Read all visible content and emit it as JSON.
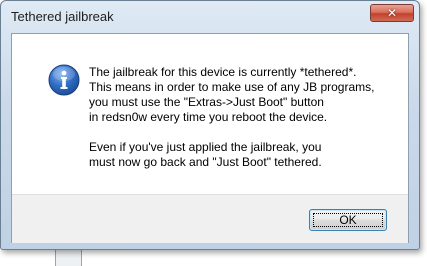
{
  "dialog": {
    "title": "Tethered jailbreak",
    "close_glyph": "✕",
    "icon": "info-icon",
    "message": {
      "paragraph1_lines": [
        "The jailbreak for this device is currently *tethered*.",
        "This means in order to make use of any JB programs,",
        "you must use the \"Extras->Just Boot\" button",
        "in redsn0w every time you reboot the device."
      ],
      "paragraph2_lines": [
        "Even if you've just applied the jailbreak, you",
        "must now go back and \"Just Boot\" tethered."
      ]
    },
    "ok_label": "OK"
  },
  "colors": {
    "close_button": "#c4422c",
    "frame": "#bfd1e4",
    "info_icon": "#2a63b8"
  }
}
